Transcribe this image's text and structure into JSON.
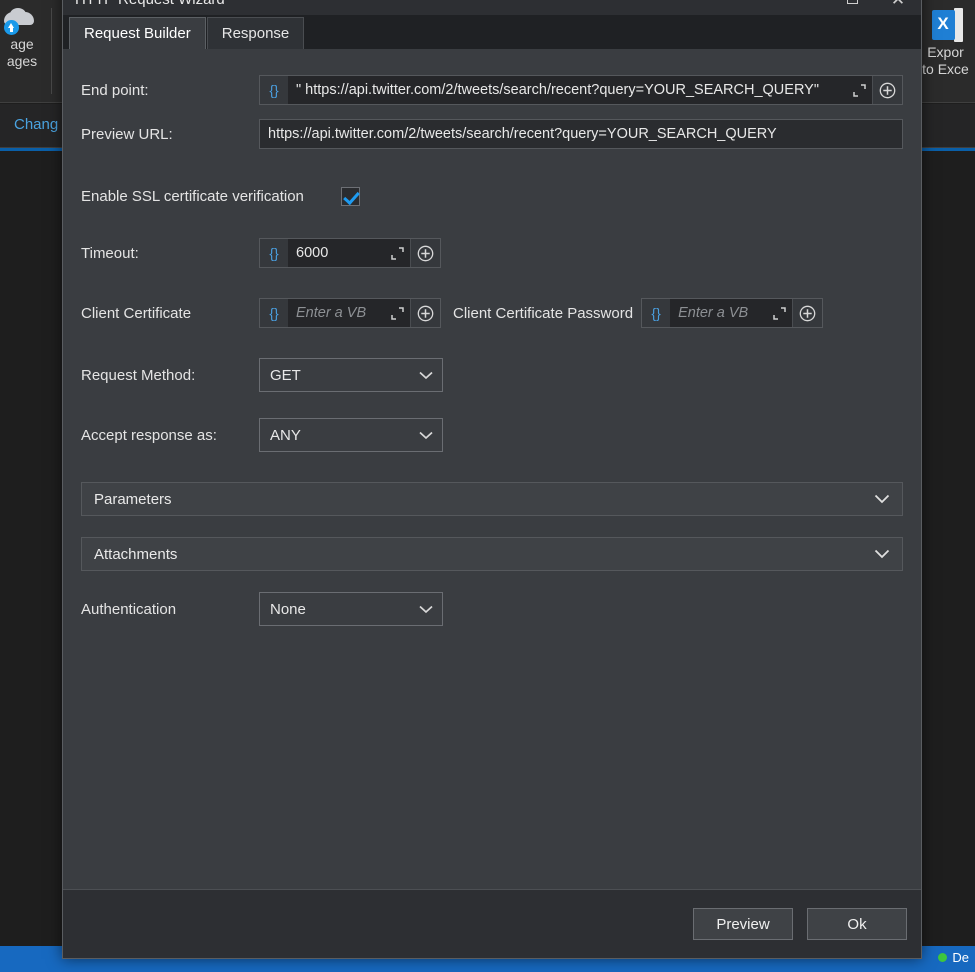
{
  "background": {
    "ribbon_left": {
      "icon": "cloud-upload-icon",
      "line1": "age",
      "line2": "ages"
    },
    "ribbon_right": {
      "icon": "excel-icon",
      "line1": "Expor",
      "line2": "to Exce"
    },
    "second_bar": {
      "link_label": "Chang"
    },
    "taskbar": {
      "status_label": "De",
      "status_color": "#3ec63e"
    }
  },
  "dialog": {
    "title": "HTTP Request Wizard",
    "window_buttons": {
      "restore": "restore-icon",
      "close": "close-icon"
    },
    "tabs": [
      {
        "label": "Request Builder",
        "active": true
      },
      {
        "label": "Response",
        "active": false
      }
    ],
    "endpoint": {
      "label": "End point:",
      "badge": "{}",
      "value": "\" https://api.twitter.com/2/tweets/search/recent?query=YOUR_SEARCH_QUERY\"",
      "expand_icon": "expand-icon",
      "add_icon": "plus-circle-icon"
    },
    "preview_url": {
      "label": "Preview URL:",
      "value": "https://api.twitter.com/2/tweets/search/recent?query=YOUR_SEARCH_QUERY"
    },
    "ssl": {
      "label": "Enable SSL certificate verification",
      "checked": true
    },
    "timeout": {
      "label": "Timeout:",
      "badge": "{}",
      "value": "6000"
    },
    "client_certificate": {
      "label": "Client Certificate",
      "badge": "{}",
      "placeholder": "Enter a VB"
    },
    "client_certificate_password": {
      "label": "Client Certificate Password",
      "badge": "{}",
      "placeholder": "Enter a VB"
    },
    "request_method": {
      "label": "Request Method:",
      "value": "GET"
    },
    "accept_response": {
      "label": "Accept response as:",
      "value": "ANY"
    },
    "parameters_panel": {
      "label": "Parameters"
    },
    "attachments_panel": {
      "label": "Attachments"
    },
    "authentication": {
      "label": "Authentication",
      "value": "None"
    },
    "footer": {
      "preview_label": "Preview",
      "ok_label": "Ok"
    }
  },
  "colors": {
    "dialog_bg": "#3a3d41",
    "field_bg": "#252629",
    "accent_blue": "#1e9bf0",
    "link_blue": "#4aa3e0",
    "taskbar_blue": "#1769c0"
  }
}
